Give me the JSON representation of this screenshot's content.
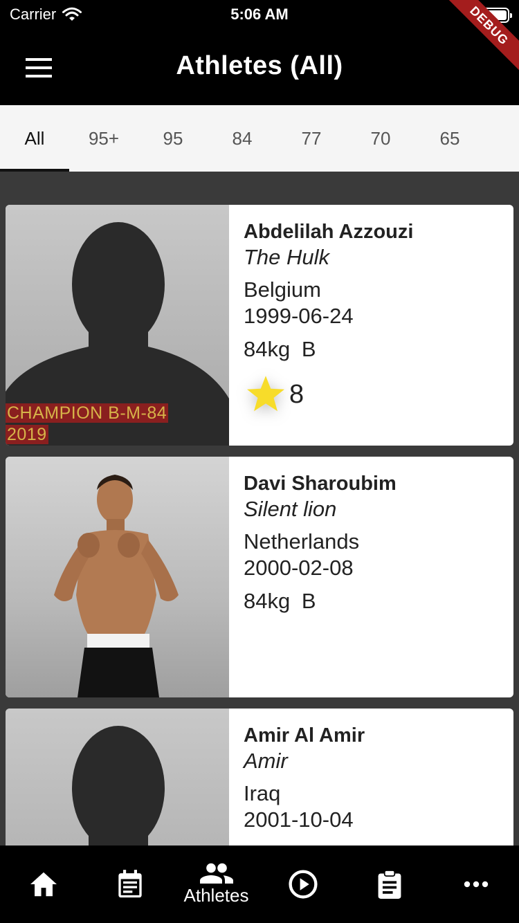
{
  "status_bar": {
    "carrier": "Carrier",
    "time": "5:06 AM"
  },
  "app_bar": {
    "title": "Athletes (All)",
    "debug_label": "DEBUG"
  },
  "tabs": [
    {
      "label": "All",
      "active": true
    },
    {
      "label": "95+",
      "active": false
    },
    {
      "label": "95",
      "active": false
    },
    {
      "label": "84",
      "active": false
    },
    {
      "label": "77",
      "active": false
    },
    {
      "label": "70",
      "active": false
    },
    {
      "label": "65",
      "active": false
    }
  ],
  "athletes": [
    {
      "name": "Abdelilah Azzouzi",
      "nickname": "The Hulk",
      "country": "Belgium",
      "dob": "1999-06-24",
      "weight_class": "84kg  B",
      "champion_line1": "CHAMPION B-M-84",
      "champion_line2": "2019",
      "stars": "8"
    },
    {
      "name": "Davi Sharoubim",
      "nickname": "Silent lion",
      "country": "Netherlands",
      "dob": "2000-02-08",
      "weight_class": "84kg  B"
    },
    {
      "name": "Amir Al Amir",
      "nickname": "Amir",
      "country": "Iraq",
      "dob": "2001-10-04"
    }
  ],
  "bottom_nav": {
    "active_label": "Athletes"
  },
  "colors": {
    "star": "#f7dc2a",
    "champion_bg": "#8a1f1f",
    "champion_text": "#d6b449",
    "debug_ribbon": "#a41d1d"
  }
}
